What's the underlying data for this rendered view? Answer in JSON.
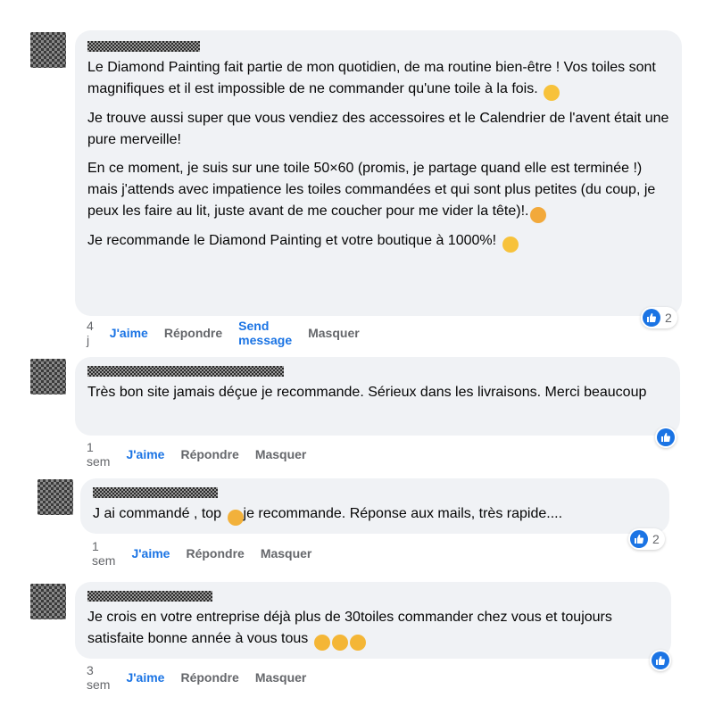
{
  "comments": [
    {
      "paragraphs": [
        "Le Diamond Painting fait partie de mon quotidien, de ma routine bien-être ! Vos toiles sont magnifiques et il est impossible de ne commander qu'une toile à la fois.",
        "Je trouve aussi super que vous vendiez des accessoires et le Calendrier de l'avent était une pure merveille!",
        "En ce moment, je suis sur une toile 50×60 (promis, je partage quand elle est terminée !) mais j'attends avec impatience les toiles commandées et qui sont plus petites (du coup, je peux les faire au lit, juste avant de me coucher pour me vider la tête)!.",
        "Je recommande le Diamond Painting et votre boutique à 1000%!"
      ],
      "time": "4 j",
      "like_label": "J'aime",
      "reply_label": "Répondre",
      "send_label": "Send message",
      "hide_label": "Masquer",
      "reaction_count": "2"
    },
    {
      "paragraphs": [
        "Très bon site jamais déçue je recommande. Sérieux dans les livraisons. Merci beaucoup"
      ],
      "time": "1 sem",
      "like_label": "J'aime",
      "reply_label": "Répondre",
      "hide_label": "Masquer",
      "reaction_count": ""
    },
    {
      "text_before": "J ai commandé , top",
      "text_after": "je recommande. Réponse aux mails, très rapide....",
      "time": "1 sem",
      "like_label": "J'aime",
      "reply_label": "Répondre",
      "hide_label": "Masquer",
      "reaction_count": "2"
    },
    {
      "paragraphs": [
        "Je crois en votre entreprise déjà plus de 30toiles commander chez vous et toujours satisfaite bonne année à vous tous"
      ],
      "time": "3 sem",
      "like_label": "J'aime",
      "reply_label": "Répondre",
      "hide_label": "Masquer",
      "reaction_count": ""
    }
  ],
  "colors": {
    "accent": "#1b74e4",
    "bubble": "#f0f2f5",
    "meta": "#65676b"
  },
  "icons": {
    "reaction": "thumbs-up-icon",
    "emoji_1": "grinning-face-icon",
    "emoji_2": "star-struck-icon",
    "emoji_3": "beaming-face-icon",
    "emoji_4": "heart-eyes-icon",
    "emoji_5": "kissing-heart-icon"
  }
}
